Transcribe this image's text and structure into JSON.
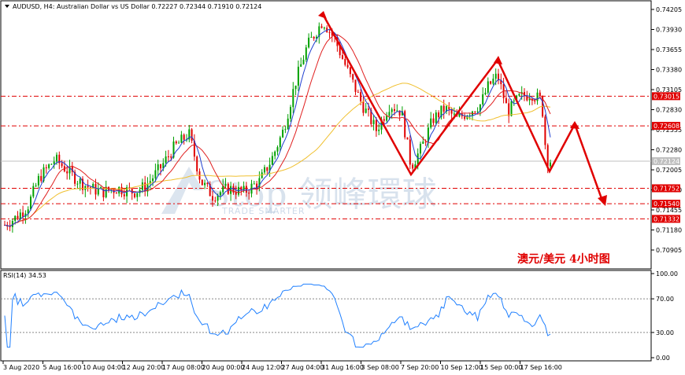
{
  "header": {
    "symbol_line": "AUDUSD, H4:  Australian Dollar vs US Dollar  0.72227 0.72344 0.71910 0.72124"
  },
  "watermark": {
    "brand": "Stop 领峰環球",
    "tagline": "TRADE SMARTER"
  },
  "annotation": {
    "text": "澳元/美元  4小时图"
  },
  "price_axis": {
    "ticks": [
      "0.74205",
      "0.73930",
      "0.73655",
      "0.73380",
      "0.73105",
      "0.72830",
      "0.72555",
      "0.72280",
      "0.72005",
      "0.71730",
      "0.71455",
      "0.71180",
      "0.70905"
    ]
  },
  "levels": {
    "labels": [
      "0.73015",
      "0.72608",
      "0.71752",
      "0.71540",
      "0.71332"
    ],
    "current_label": "0.72124"
  },
  "time_axis": {
    "labels": [
      "3 Aug 2020",
      "5 Aug 16:00",
      "10 Aug 04:00",
      "12 Aug 20:00",
      "17 Aug 08:00",
      "20 Aug 00:00",
      "24 Aug 12:00",
      "27 Aug 04:00",
      "31 Aug 16:00",
      "3 Sep 08:00",
      "7 Sep 20:00",
      "10 Sep 12:00",
      "15 Sep 00:00",
      "17 Sep 16:00"
    ]
  },
  "rsi": {
    "label": "RSI(14) 34.53",
    "ticks": [
      "100.00",
      "70.00",
      "30.00",
      "0.00"
    ]
  },
  "colors": {
    "up": "#00a000",
    "down": "#e00000",
    "level": "#e00000",
    "ma_fast": "#1f3fd0",
    "ma_mid": "#e02020",
    "ma_slow": "#f0c030",
    "rsi": "#2080ff",
    "arrow": "#e00000"
  },
  "chart_data": {
    "type": "candlestick",
    "title": "AUDUSD, H4: Australian Dollar vs US Dollar",
    "ylim": [
      0.7075,
      0.7428
    ],
    "levels": [
      0.73015,
      0.72608,
      0.71752,
      0.7154,
      0.71332
    ],
    "current_price": 0.72124,
    "ohlc_last": {
      "open": 0.72227,
      "high": 0.72344,
      "low": 0.7191,
      "close": 0.72124
    },
    "rsi_value": 34.53,
    "rsi_levels": [
      70,
      30
    ]
  }
}
